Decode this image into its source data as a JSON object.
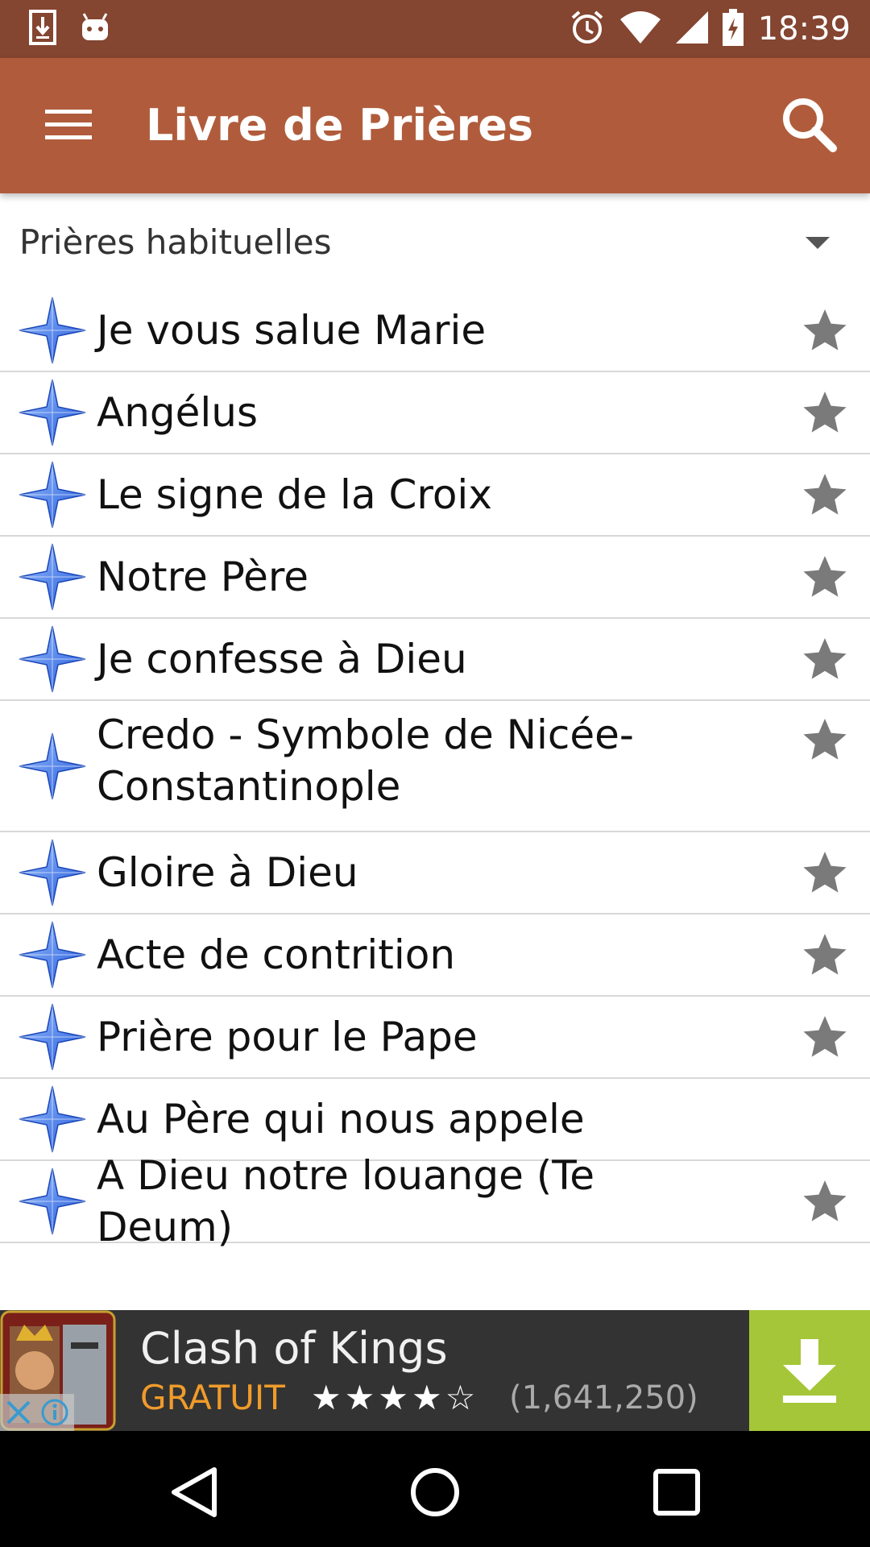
{
  "status_bar": {
    "time": "18:39",
    "icons": [
      "download-icon",
      "android-icon",
      "alarm-icon",
      "wifi-icon",
      "signal-icon",
      "battery-charging-icon"
    ]
  },
  "app_bar": {
    "title": "Livre de Prières",
    "menu_icon": "hamburger-menu-icon",
    "search_icon": "search-icon"
  },
  "category": {
    "label": "Prières habituelles"
  },
  "prayers": [
    {
      "label": "Je vous salue Marie",
      "starred": true
    },
    {
      "label": "Angélus",
      "starred": true
    },
    {
      "label": "Le signe de la Croix",
      "starred": true
    },
    {
      "label": "Notre Père",
      "starred": true
    },
    {
      "label": "Je confesse à Dieu",
      "starred": true
    },
    {
      "label": "Credo - Symbole de Nicée-Constantinople",
      "starred": true
    },
    {
      "label": "Gloire à Dieu",
      "starred": true
    },
    {
      "label": "Acte de contrition",
      "starred": true
    },
    {
      "label": "Prière pour le Pape",
      "starred": true
    },
    {
      "label": "Au Père qui nous appele",
      "starred": false
    },
    {
      "label": "A Dieu notre louange (Te Deum)",
      "starred": true
    }
  ],
  "ad": {
    "title": "Clash of Kings",
    "price": "GRATUIT",
    "rating": "★★★★☆",
    "rating_count": "(1,641,250)",
    "download_icon": "download-arrow-icon"
  },
  "colors": {
    "status_bar": "#844531",
    "app_bar": "#b05c3c",
    "ad_background": "#333333",
    "ad_download": "#a5c638",
    "ad_price": "#f09b2a"
  }
}
